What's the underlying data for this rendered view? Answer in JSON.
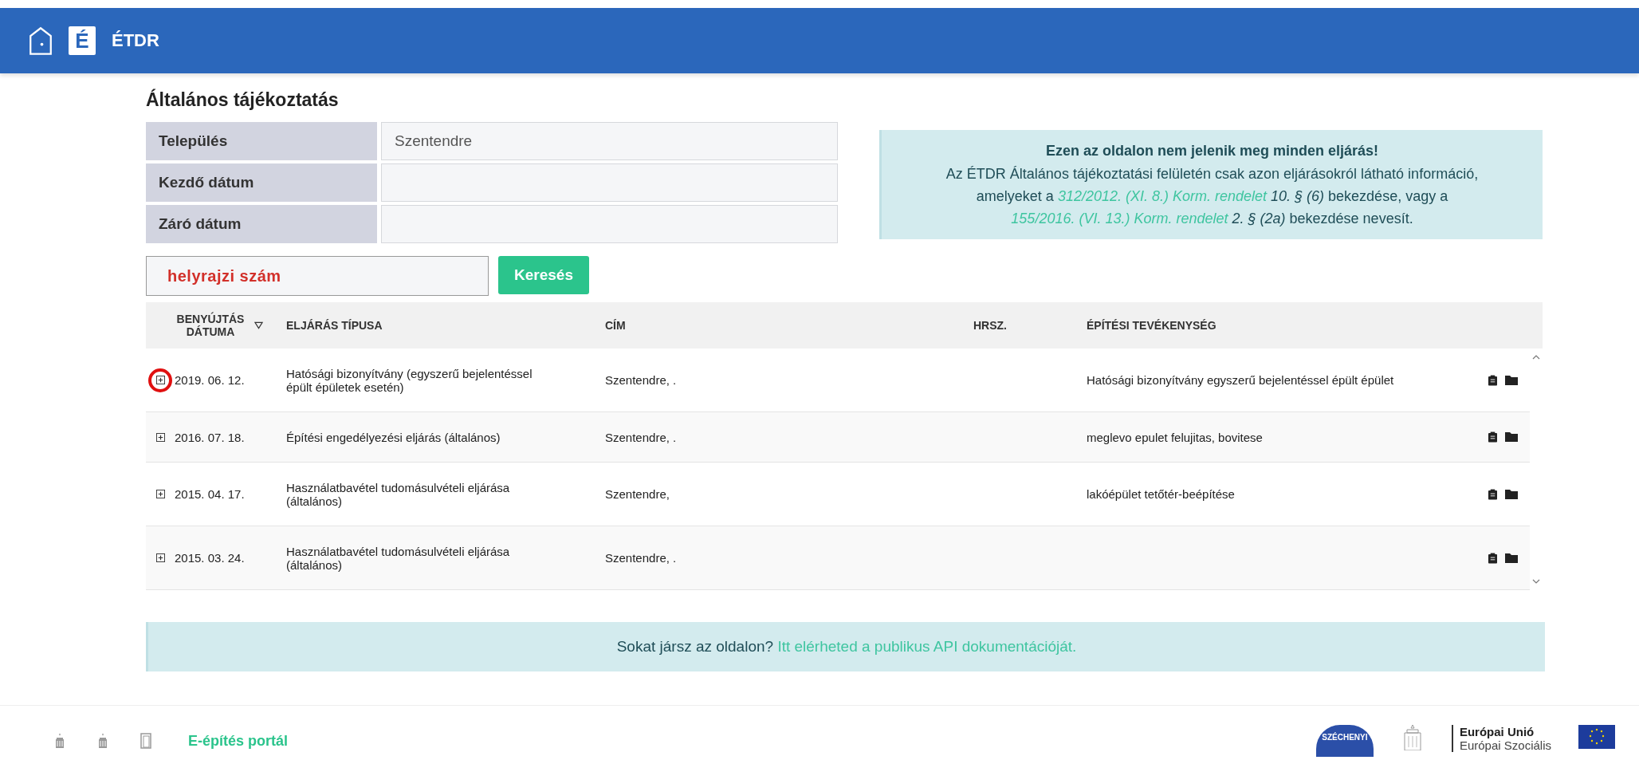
{
  "header": {
    "title": "ÉTDR",
    "logo_letter": "É"
  },
  "page_title": "Általános tájékoztatás",
  "filters": [
    {
      "label": "Település",
      "value": "Szentendre"
    },
    {
      "label": "Kezdő dátum"
    },
    {
      "label": "Záró dátum"
    }
  ],
  "notice": {
    "heading": "Ezen az oldalon nem jelenik meg minden eljárás!",
    "parts": [
      {
        "kind": "text",
        "text": "Az ÉTDR Általános tájékoztatási felületén csak azon eljárásokról látható információ, amelyeket a "
      },
      {
        "kind": "link",
        "text": "312/2012. (XI. 8.) Korm. rendelet"
      },
      {
        "kind": "em",
        "text": " 10. § (6)"
      },
      {
        "kind": "text",
        "text": " bekezdése, vagy a "
      },
      {
        "kind": "link",
        "text": "155/2016. (VI. 13.) Korm. rendelet"
      },
      {
        "kind": "em",
        "text": " 2. § (2a)"
      },
      {
        "kind": "text",
        "text": " bekezdése nevesít."
      }
    ]
  },
  "search": {
    "placeholder": "helyrajzi szám",
    "button": "Keresés"
  },
  "table": {
    "columns": [
      {
        "label": "BENYÚJTÁS DÁTUMA",
        "sorted": true
      },
      {
        "label": "ELJÁRÁS TÍPUSA",
        "sorted": false
      },
      {
        "label": "CÍM",
        "sorted": false
      },
      {
        "label": "HRSZ.",
        "sorted": false
      },
      {
        "label": "ÉPÍTÉSI TEVÉKENYSÉG",
        "sorted": false
      }
    ],
    "rows": [
      {
        "date": "2019. 06. 12.",
        "type": "Hatósági bizonyítvány (egyszerű bejelentéssel épült épületek esetén)",
        "address": "Szentendre, .",
        "activity": "Hatósági bizonyítvány egyszerű bejelentéssel épült épület",
        "circled": true
      },
      {
        "date": "2016. 07. 18.",
        "type": "Építési engedélyezési eljárás (általános)",
        "address": "Szentendre, .",
        "activity": "meglevo epulet felujitas, bovitese",
        "circled": false
      },
      {
        "date": "2015. 04. 17.",
        "type": "Használatbavétel tudomásulvételi eljárása (általános)",
        "address": "Szentendre,",
        "activity": "lakóépület tetőtér-beépítése",
        "circled": false
      },
      {
        "date": "2015. 03. 24.",
        "type": "Használatbavétel tudomásulvételi eljárása (általános)",
        "address": "Szentendre, .",
        "circled": false
      }
    ]
  },
  "api_banner": {
    "text": "Sokat jársz az oldalon?",
    "link": "Itt elérheted a publikus API dokumentációját."
  },
  "footer": {
    "portal_link": "E-építés portál",
    "seal_text": "SZÉCHENYI",
    "eu_title": "Európai Unió",
    "eu_subtitle": "Európai Szociális"
  }
}
